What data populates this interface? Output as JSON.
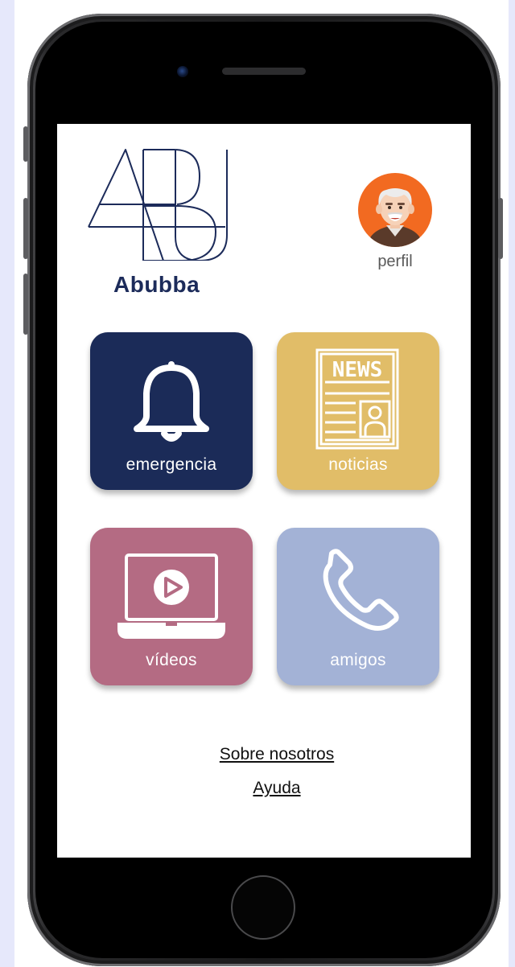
{
  "app": {
    "name": "Abubba",
    "logo_text": "ABU"
  },
  "profile": {
    "label": "perfil",
    "icon": "elderly-man-avatar"
  },
  "tiles": [
    {
      "label": "emergencia",
      "icon": "bell-icon",
      "color": "#1b2b58"
    },
    {
      "label": "noticias",
      "icon": "newspaper-icon",
      "icon_text": "NEWS",
      "color": "#e1bd68"
    },
    {
      "label": "vídeos",
      "icon": "laptop-play-icon",
      "color": "#b46b83"
    },
    {
      "label": "amigos",
      "icon": "phone-icon",
      "color": "#a3b2d6"
    }
  ],
  "footer": {
    "about": "Sobre nosotros",
    "help": "Ayuda"
  },
  "colors": {
    "brand": "#1c2b5a",
    "avatar_bg": "#f26a21",
    "page_bg": "#e6e8fb"
  }
}
